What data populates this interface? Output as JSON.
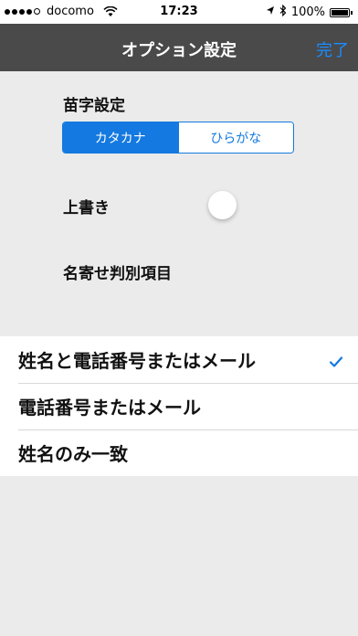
{
  "status_bar": {
    "carrier": "docomo",
    "time": "17:23",
    "battery": "100%",
    "signal_bars_filled": 4,
    "signal_bars_total": 5
  },
  "nav": {
    "title": "オプション設定",
    "done_label": "完了"
  },
  "surname": {
    "label": "苗字設定",
    "options": [
      "カタカナ",
      "ひらがな"
    ],
    "selected": "カタカナ"
  },
  "overwrite": {
    "label": "上書き",
    "enabled": false
  },
  "matching": {
    "label": "名寄せ判別項目",
    "options": [
      "姓名と電話番号またはメール",
      "電話番号またはメール",
      "姓名のみ一致"
    ],
    "selected": "姓名と電話番号またはメール"
  },
  "colors": {
    "accent": "#1479e0",
    "nav_background": "#4a4a4a",
    "page_background": "#ebebeb"
  }
}
